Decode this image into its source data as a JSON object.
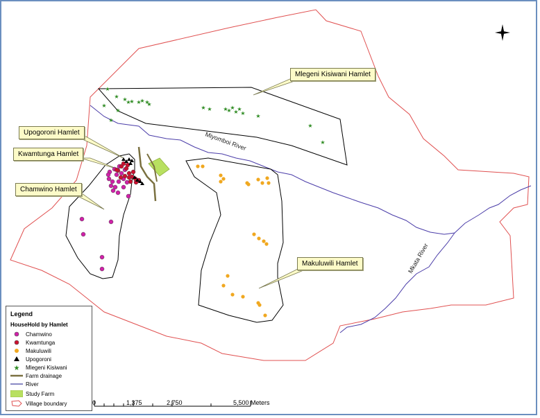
{
  "callouts": {
    "mlegeni": "Mlegeni Kisiwani Hamlet",
    "upogoroni": "Upogoroni Hamlet",
    "kwamtunga": "Kwamtunga Hamlet",
    "chamwino": "Chamwino Hamlet",
    "makuluwili": "Makuluwili Hamlet"
  },
  "rivers": {
    "miyomboi": "Miyomboi River",
    "mkata": "Mkata River"
  },
  "legend": {
    "title": "Legend",
    "subtitle": "HouseHold by Hamlet",
    "items": [
      {
        "label": "Chamwino",
        "symbol": "circle",
        "color": "#d020a8"
      },
      {
        "label": "Kwamtunga",
        "symbol": "circle",
        "color": "#cc1030"
      },
      {
        "label": "Makuluwili",
        "symbol": "circle",
        "color": "#f0a820"
      },
      {
        "label": "Upogoroni",
        "symbol": "triangle",
        "color": "#000000"
      },
      {
        "label": "Mlegeni Kisiwani",
        "symbol": "star",
        "color": "#2e8b22"
      },
      {
        "label": "Farm drainage",
        "symbol": "line",
        "color": "#7a7040"
      },
      {
        "label": "River",
        "symbol": "line",
        "color": "#4040a0"
      },
      {
        "label": "Study Farm",
        "symbol": "fill",
        "color": "#b8e060"
      },
      {
        "label": "Village boundary",
        "symbol": "outline",
        "color": "#e05050"
      }
    ]
  },
  "scale": {
    "ticks": [
      "0",
      "1,375",
      "2,750",
      "5,500 Meters"
    ]
  },
  "colors": {
    "boundary": "#e05050",
    "river": "#4a3ca8",
    "hamlet_outline": "#000000"
  },
  "north_arrow": "north-arrow-icon"
}
